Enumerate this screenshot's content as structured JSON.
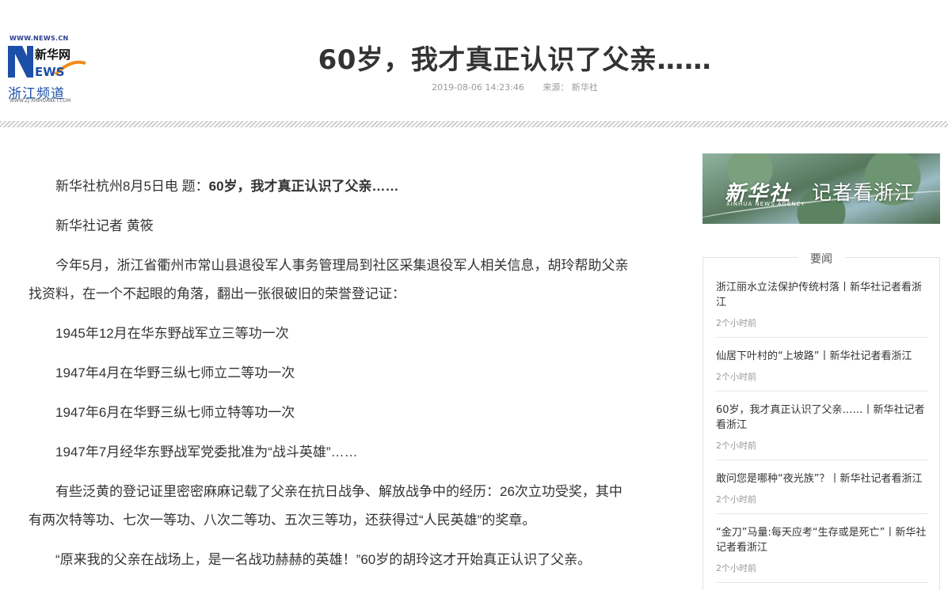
{
  "header": {
    "logo_site": "WWW.NEWS.CN",
    "logo_mark_letters": "NEWS",
    "logo_mark_cn": "新华网",
    "logo_channel": "浙江频道",
    "logo_url": "WWW.ZJ.XINHUANET.COM",
    "title": "60岁，我才真正认识了父亲……",
    "datetime": "2019-08-06 14:23:46",
    "source": "来源：  新华社"
  },
  "article": {
    "dateline_prefix": "新华社杭州8月5日电 题：",
    "dateline_title": "60岁，我才真正认识了父亲……",
    "paragraphs": [
      "新华社记者 黄筱",
      "今年5月，浙江省衢州市常山县退役军人事务管理局到社区采集退役军人相关信息，胡玲帮助父亲找资料，在一个不起眼的角落，翻出一张很破旧的荣誉登记证：",
      "1945年12月在华东野战军立三等功一次",
      "1947年4月在华野三纵七师立二等功一次",
      "1947年6月在华野三纵七师立特等功一次",
      "1947年7月经华东野战军党委批准为“战斗英雄”……",
      "有些泛黄的登记证里密密麻麻记载了父亲在抗日战争、解放战争中的经历：26次立功受奖，其中有两次特等功、七次一等功、八次二等功、五次三等功，还获得过“人民英雄”的奖章。",
      "“原来我的父亲在战场上，是一名战功赫赫的英雄！”60岁的胡玲这才开始真正认识了父亲。"
    ]
  },
  "banner": {
    "brand": "新华社",
    "brand_en": "XINHUA NEWS AGENCY",
    "slogan": "记者看浙江"
  },
  "news_box": {
    "title": "要闻",
    "items": [
      {
        "headline": "浙江丽水立法保护传统村落丨新华社记者看浙江",
        "time": "2个小时前"
      },
      {
        "headline": "仙居下叶村的“上坡路”丨新华社记者看浙江",
        "time": "2个小时前"
      },
      {
        "headline": "60岁，我才真正认识了父亲……丨新华社记者看浙江",
        "time": "2个小时前"
      },
      {
        "headline": "敢问您是哪种“夜光族”？丨新华社记者看浙江",
        "time": "2个小时前"
      },
      {
        "headline": "“金刀”马量:每天应考“生存或是死亡”丨新华社记者看浙江",
        "time": "2个小时前"
      }
    ]
  },
  "colors": {
    "logo_blue": "#1c4fa8",
    "logo_orange": "#f08a1c",
    "text": "#333333",
    "muted": "#999999"
  }
}
